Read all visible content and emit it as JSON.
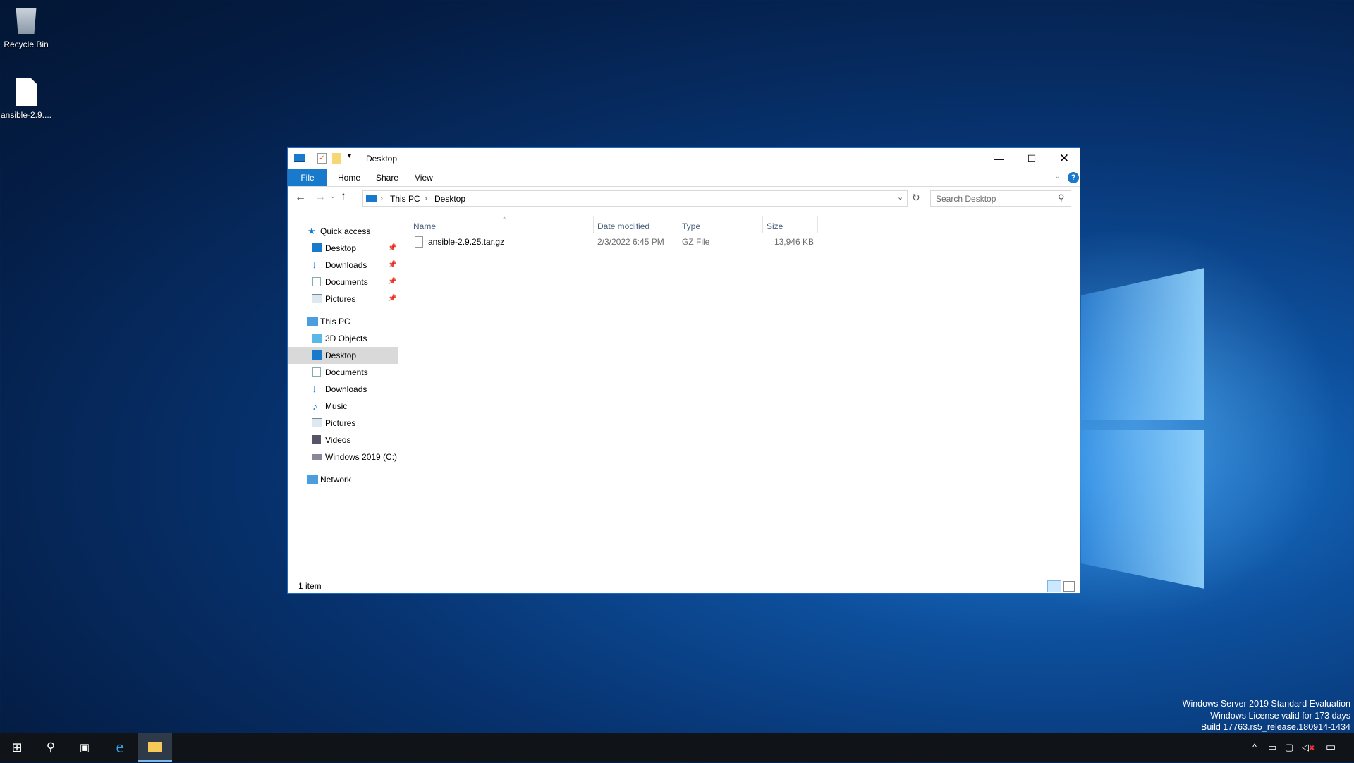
{
  "desktop": {
    "icons": [
      {
        "label": "Recycle Bin",
        "icon": "recycle-bin-icon"
      },
      {
        "label": "ansible-2.9....",
        "icon": "file-icon"
      }
    ]
  },
  "window": {
    "title": "Desktop",
    "ribbon_tabs": [
      "File",
      "Home",
      "Share",
      "View"
    ],
    "address": {
      "crumbs": [
        "This PC",
        "Desktop"
      ]
    },
    "search_placeholder": "Search Desktop",
    "nav": {
      "quick_access": {
        "label": "Quick access",
        "items": [
          "Desktop",
          "Downloads",
          "Documents",
          "Pictures"
        ]
      },
      "this_pc": {
        "label": "This PC",
        "items": [
          "3D Objects",
          "Desktop",
          "Documents",
          "Downloads",
          "Music",
          "Pictures",
          "Videos",
          "Windows 2019 (C:)"
        ]
      },
      "network": "Network",
      "selected": "Desktop"
    },
    "columns": [
      "Name",
      "Date modified",
      "Type",
      "Size"
    ],
    "files": [
      {
        "name": "ansible-2.9.25.tar.gz",
        "date": "2/3/2022 6:45 PM",
        "type": "GZ File",
        "size": "13,946 KB"
      }
    ],
    "status": "1 item"
  },
  "watermark": [
    "Windows Server 2019 Standard Evaluation",
    "Windows License valid for 173 days",
    "Build 17763.rs5_release.180914-1434"
  ],
  "colors": {
    "accent": "#1979ca",
    "selected": "#cce8ff"
  }
}
